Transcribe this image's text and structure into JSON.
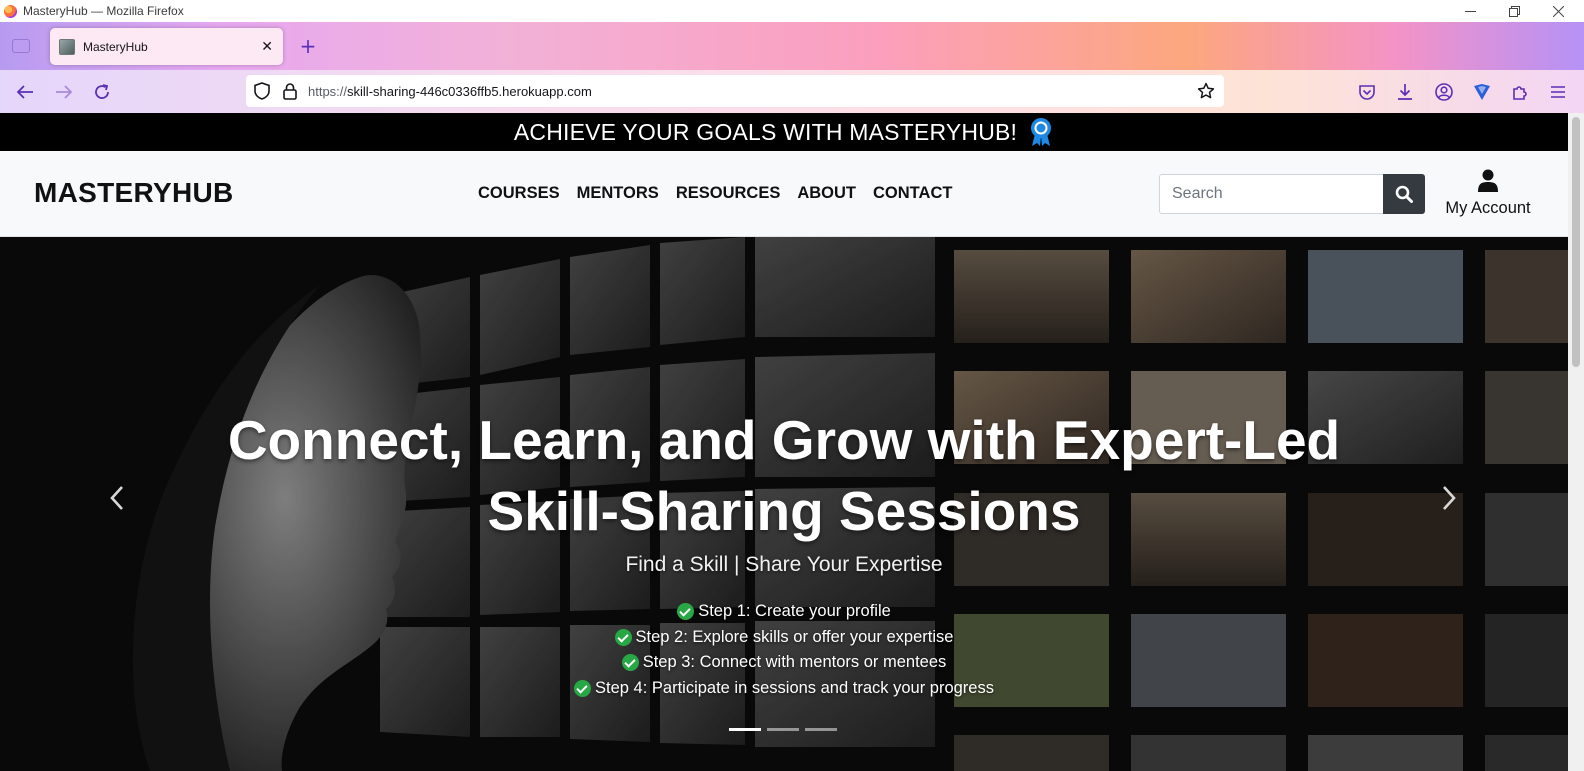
{
  "window": {
    "title": "MasteryHub — Mozilla Firefox",
    "controls": [
      "minimize",
      "restore",
      "close"
    ]
  },
  "tabs": [
    {
      "label": "MasteryHub",
      "active": true,
      "favicon": "site-favicon"
    }
  ],
  "toolbar": {
    "url_protocol": "https://",
    "url_rest": "skill-sharing-446c0336ffb5.herokuapp.com",
    "icons": [
      "back-icon",
      "forward-icon",
      "reload-icon",
      "shield-icon",
      "lock-icon",
      "bookmark-star-icon",
      "pocket-icon",
      "downloads-icon",
      "account-icon",
      "extension-vpn-icon",
      "extensions-icon",
      "menu-icon"
    ]
  },
  "promo": {
    "text": "ACHIEVE YOUR GOALS WITH MASTERYHUB!",
    "icon": "award-ribbon-icon",
    "accent": "#1e88e5"
  },
  "header": {
    "brand": "MASTERYHUB",
    "nav": [
      "COURSES",
      "MENTORS",
      "RESOURCES",
      "ABOUT",
      "CONTACT"
    ],
    "search_placeholder": "Search",
    "account_label": "My Account"
  },
  "hero": {
    "title": "Connect, Learn, and Grow with Expert-Led Skill-Sharing Sessions",
    "subtitle": "Find a Skill | Share Your Expertise",
    "steps": [
      "Step 1: Create your profile",
      "Step 2: Explore skills or offer your expertise",
      "Step 3: Connect with mentors or mentees",
      "Step 4: Participate in sessions and track your progress"
    ],
    "slide_count": 3,
    "active_slide": 1,
    "check_color": "#28a745"
  }
}
